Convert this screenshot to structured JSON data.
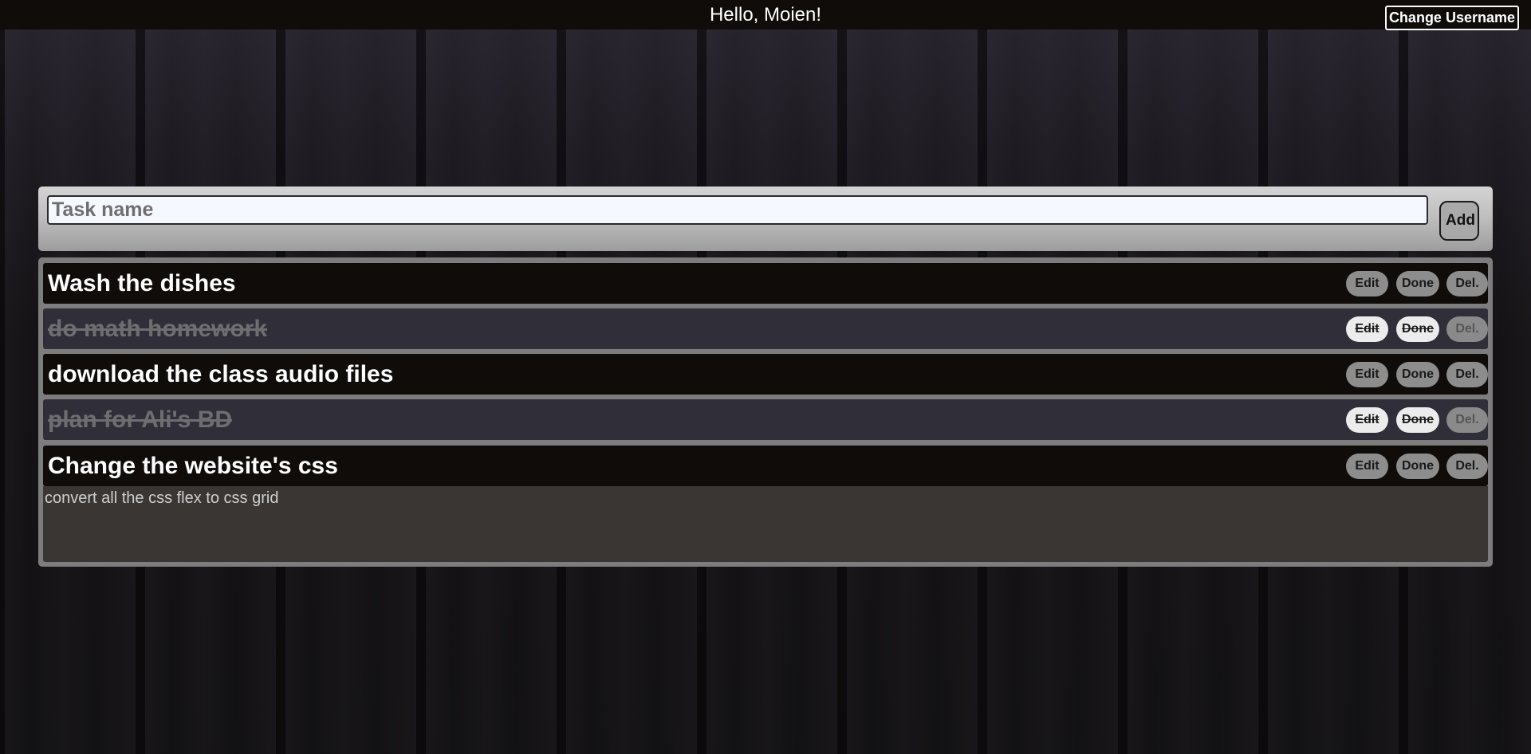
{
  "header": {
    "greeting": "Hello, Moien!",
    "change_username_label": "Change Username"
  },
  "new_task": {
    "placeholder": "Task name",
    "value": "",
    "add_label": "Add"
  },
  "buttons": {
    "edit": "Edit",
    "done": "Done",
    "delete": "Del."
  },
  "tasks": [
    {
      "title": "Wash the dishes",
      "completed": false
    },
    {
      "title": "do math homework",
      "completed": true
    },
    {
      "title": "download the class audio files",
      "completed": false
    },
    {
      "title": "plan for Ali's BD",
      "completed": true
    },
    {
      "title": "Change the website's css",
      "completed": false,
      "expanded": true,
      "description": "convert all the css flex to css grid"
    }
  ]
}
